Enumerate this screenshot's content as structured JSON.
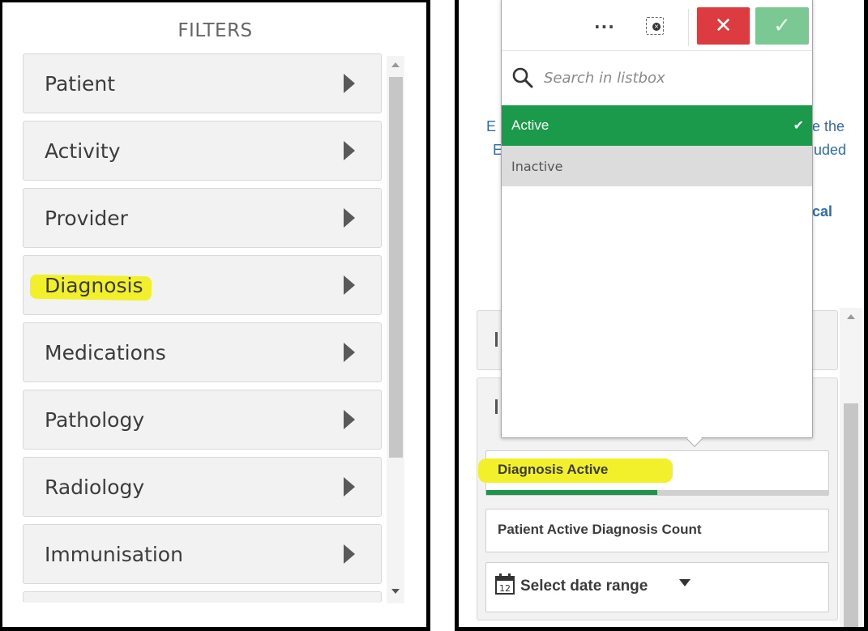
{
  "filters_panel": {
    "title": "FILTERS",
    "items": [
      {
        "label": "Patient"
      },
      {
        "label": "Activity"
      },
      {
        "label": "Provider"
      },
      {
        "label": "Diagnosis",
        "highlighted": true
      },
      {
        "label": "Medications"
      },
      {
        "label": "Pathology"
      },
      {
        "label": "Radiology"
      },
      {
        "label": "Immunisation"
      }
    ],
    "icons": {
      "item_arrow": "caret-right-icon",
      "scroll_up": "scroll-up-arrow-icon",
      "scroll_down": "scroll-down-arrow-icon"
    }
  },
  "listbox_popup": {
    "toolbar": {
      "more_label": "···",
      "clear_selections_icon": "clear-selections-icon",
      "cancel_label": "✕",
      "confirm_label": "✓"
    },
    "search": {
      "placeholder": "Search in listbox",
      "value": "",
      "icon": "search-icon"
    },
    "options": [
      {
        "label": "Active",
        "state": "selected",
        "icon": "check-icon"
      },
      {
        "label": "Inactive",
        "state": "alternative"
      }
    ],
    "colors": {
      "selected": "#1b9a4b",
      "alternative": "#dcdcdc",
      "cancel": "#dc3b40",
      "confirm": "#7bc894"
    }
  },
  "background_text": {
    "line1_left": "E",
    "line1_right": "e the",
    "line2_left": "E",
    "line2_right": "uded",
    "line3_right": "cal"
  },
  "fields_panel": {
    "fields": [
      {
        "label": "Diagnosis Active",
        "highlighted": true,
        "selection_ratio": 0.5
      },
      {
        "label": "Patient Active Diagnosis Count"
      }
    ],
    "date_range": {
      "label": "Select date range",
      "icon": "calendar-icon"
    },
    "colors": {
      "progress_fill": "#1e9448",
      "progress_track": "#d0d0d0",
      "highlight": "#f2f02a"
    }
  }
}
